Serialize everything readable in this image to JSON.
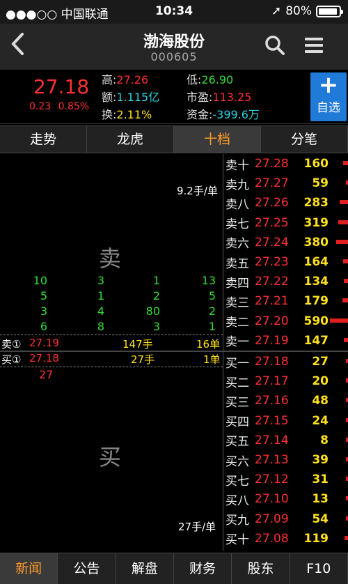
{
  "status": {
    "carrier": "●●●○○ 中国联通",
    "time": "10:34",
    "battery": "80%"
  },
  "header": {
    "title": "渤海股份",
    "code": "000605"
  },
  "quote": {
    "price": "27.18",
    "change": "0.23",
    "change_pct": "0.85%",
    "high_label": "高:",
    "high": "27.26",
    "amount_label": "额:",
    "amount": "1.115亿",
    "turnover_label": "换:",
    "turnover": "2.11%",
    "low_label": "低:",
    "low": "26.90",
    "pe_label": "市盈:",
    "pe": "113.25",
    "fund_label": "资金:",
    "fund": "-399.6万",
    "add_plus": "+",
    "add_label": "自选"
  },
  "tabs": [
    "走势",
    "龙虎",
    "十档",
    "分笔"
  ],
  "active_tab": 2,
  "left": {
    "sell_big": "卖",
    "buy_big": "买",
    "sell_unit": "9.2手/单",
    "buy_unit": "27手/单",
    "sell_queue": [
      [
        "10",
        "3",
        "1",
        "13"
      ],
      [
        "5",
        "1",
        "2",
        "5"
      ],
      [
        "3",
        "4",
        "80",
        "2"
      ],
      [
        "6",
        "8",
        "3",
        "1"
      ]
    ],
    "sell1": {
      "label": "卖①",
      "price": "27.19",
      "hands": "147手",
      "orders": "16单"
    },
    "buy1": {
      "label": "买①",
      "price": "27.18",
      "hands": "27手",
      "orders": "1单"
    },
    "buy_queue": [
      "27"
    ]
  },
  "asks": [
    {
      "label": "卖十",
      "price": "27.28",
      "vol": "160",
      "bar": 0.27
    },
    {
      "label": "卖九",
      "price": "27.27",
      "vol": "59",
      "bar": 0.1
    },
    {
      "label": "卖八",
      "price": "27.26",
      "vol": "283",
      "bar": 0.48
    },
    {
      "label": "卖七",
      "price": "27.25",
      "vol": "319",
      "bar": 0.54
    },
    {
      "label": "卖六",
      "price": "27.24",
      "vol": "380",
      "bar": 0.64
    },
    {
      "label": "卖五",
      "price": "27.23",
      "vol": "164",
      "bar": 0.28
    },
    {
      "label": "卖四",
      "price": "27.22",
      "vol": "134",
      "bar": 0.23
    },
    {
      "label": "卖三",
      "price": "27.21",
      "vol": "179",
      "bar": 0.3
    },
    {
      "label": "卖二",
      "price": "27.20",
      "vol": "590",
      "bar": 1.0
    },
    {
      "label": "卖一",
      "price": "27.19",
      "vol": "147",
      "bar": 0.25
    }
  ],
  "bids": [
    {
      "label": "买一",
      "price": "27.18",
      "vol": "27",
      "bar": 0.05
    },
    {
      "label": "买二",
      "price": "27.17",
      "vol": "20",
      "bar": 0.03
    },
    {
      "label": "买三",
      "price": "27.16",
      "vol": "48",
      "bar": 0.08
    },
    {
      "label": "买四",
      "price": "27.15",
      "vol": "24",
      "bar": 0.04
    },
    {
      "label": "买五",
      "price": "27.14",
      "vol": "8",
      "bar": 0.01
    },
    {
      "label": "买六",
      "price": "27.13",
      "vol": "39",
      "bar": 0.07
    },
    {
      "label": "买七",
      "price": "27.12",
      "vol": "31",
      "bar": 0.05
    },
    {
      "label": "买八",
      "price": "27.10",
      "vol": "13",
      "bar": 0.02
    },
    {
      "label": "买九",
      "price": "27.09",
      "vol": "54",
      "bar": 0.09
    },
    {
      "label": "买十",
      "price": "27.08",
      "vol": "119",
      "bar": 0.2
    }
  ],
  "bottom_tabs": [
    "新闻",
    "公告",
    "解盘",
    "财务",
    "股东",
    "F10"
  ],
  "active_bottom": 0
}
